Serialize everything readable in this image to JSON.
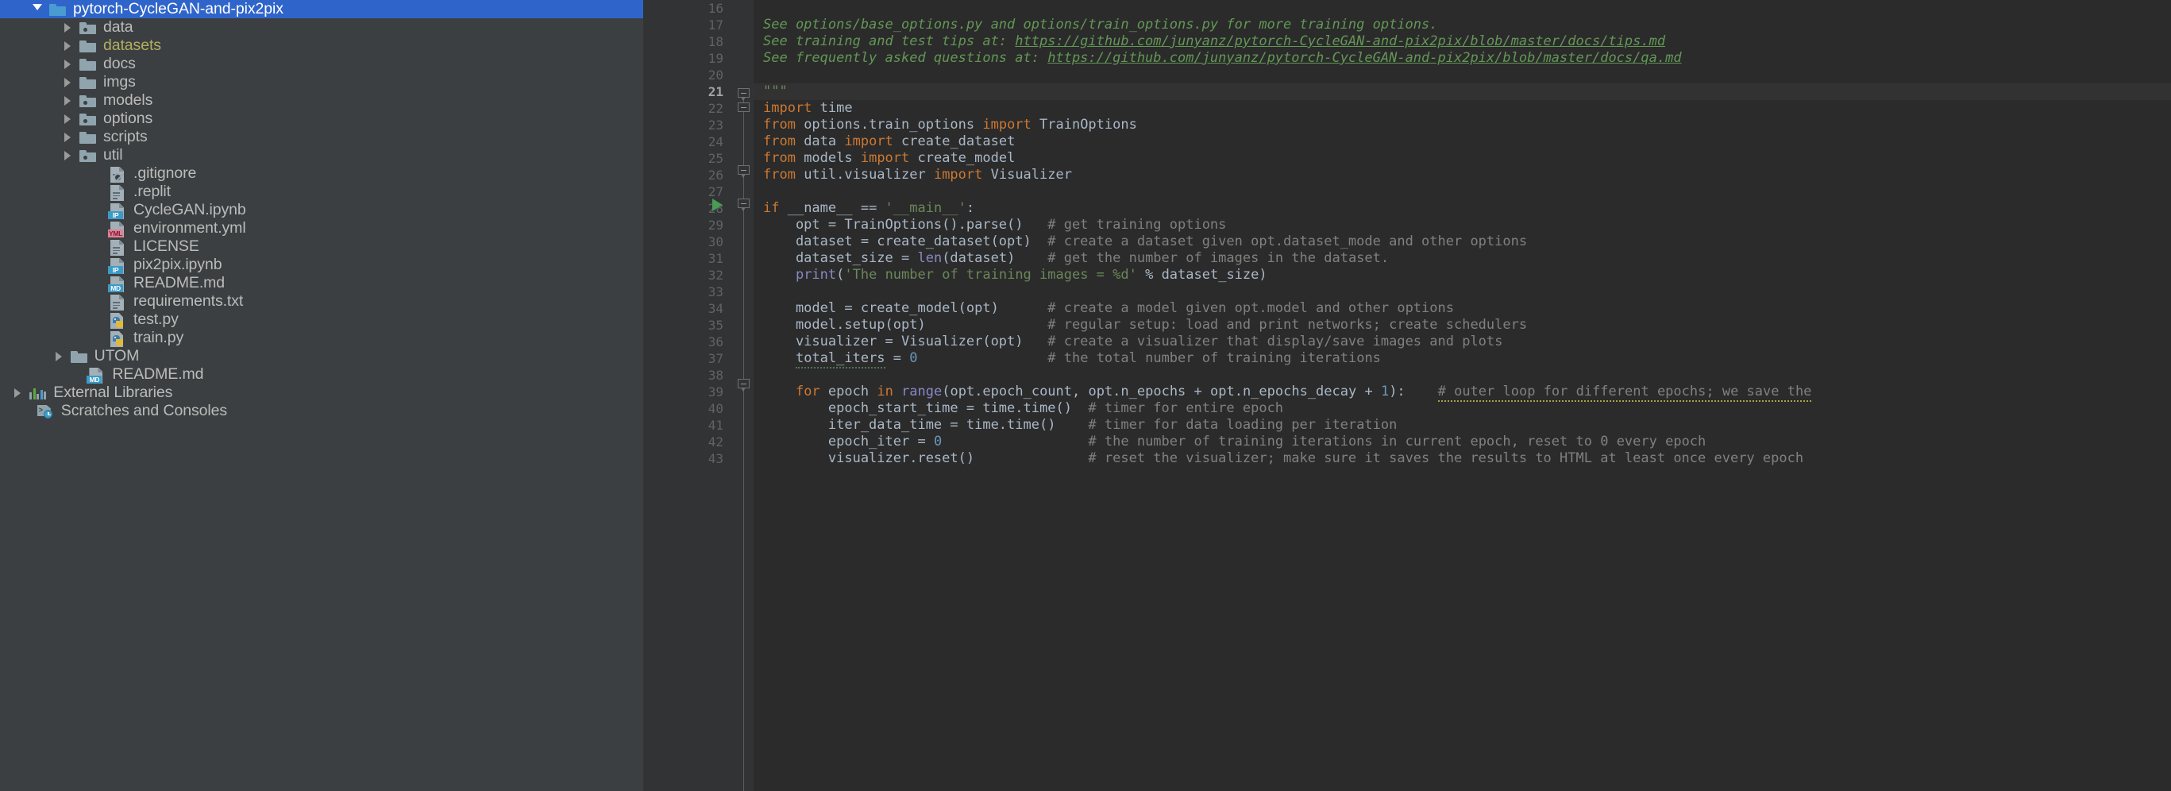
{
  "sidebar": {
    "items": [
      {
        "label": "pytorch-CycleGAN-and-pix2pix",
        "icon": "folder-open-icon",
        "kind": "folder",
        "indent": 1,
        "arrow": "open",
        "selected": true
      },
      {
        "label": "data",
        "icon": "folder-module-icon",
        "kind": "folder-module",
        "indent": 2,
        "arrow": "closed",
        "selected": false
      },
      {
        "label": "datasets",
        "icon": "folder-icon",
        "kind": "folder",
        "indent": 2,
        "arrow": "closed",
        "selected": false,
        "color": "yellow"
      },
      {
        "label": "docs",
        "icon": "folder-icon",
        "kind": "folder",
        "indent": 2,
        "arrow": "closed",
        "selected": false
      },
      {
        "label": "imgs",
        "icon": "folder-icon",
        "kind": "folder",
        "indent": 2,
        "arrow": "closed",
        "selected": false
      },
      {
        "label": "models",
        "icon": "folder-module-icon",
        "kind": "folder-module",
        "indent": 2,
        "arrow": "closed",
        "selected": false
      },
      {
        "label": "options",
        "icon": "folder-module-icon",
        "kind": "folder-module",
        "indent": 2,
        "arrow": "closed",
        "selected": false
      },
      {
        "label": "scripts",
        "icon": "folder-icon",
        "kind": "folder",
        "indent": 2,
        "arrow": "closed",
        "selected": false
      },
      {
        "label": "util",
        "icon": "folder-module-icon",
        "kind": "folder-module",
        "indent": 2,
        "arrow": "closed",
        "selected": false
      },
      {
        "label": ".gitignore",
        "icon": "gitignore-file-icon",
        "kind": "file-gitignore",
        "indent": 3,
        "arrow": "none",
        "selected": false
      },
      {
        "label": ".replit",
        "icon": "text-file-icon",
        "kind": "file-text",
        "indent": 3,
        "arrow": "none",
        "selected": false
      },
      {
        "label": "CycleGAN.ipynb",
        "icon": "notebook-file-icon",
        "kind": "file-badge",
        "badge": "IP",
        "badge_class": "ip",
        "indent": 3,
        "arrow": "none",
        "selected": false
      },
      {
        "label": "environment.yml",
        "icon": "yaml-file-icon",
        "kind": "file-badge",
        "badge": "YML",
        "badge_class": "yml",
        "indent": 3,
        "arrow": "none",
        "selected": false
      },
      {
        "label": "LICENSE",
        "icon": "text-file-icon",
        "kind": "file-text",
        "indent": 3,
        "arrow": "none",
        "selected": false
      },
      {
        "label": "pix2pix.ipynb",
        "icon": "notebook-file-icon",
        "kind": "file-badge",
        "badge": "IP",
        "badge_class": "ip",
        "indent": 3,
        "arrow": "none",
        "selected": false
      },
      {
        "label": "README.md",
        "icon": "markdown-file-icon",
        "kind": "file-badge",
        "badge": "MD",
        "badge_class": "md",
        "indent": 3,
        "arrow": "none",
        "selected": false
      },
      {
        "label": "requirements.txt",
        "icon": "text-file-icon",
        "kind": "file-text",
        "indent": 3,
        "arrow": "none",
        "selected": false
      },
      {
        "label": "test.py",
        "icon": "python-file-icon",
        "kind": "file-python",
        "indent": 3,
        "arrow": "none",
        "selected": false
      },
      {
        "label": "train.py",
        "icon": "python-file-icon",
        "kind": "file-python",
        "indent": 3,
        "arrow": "none",
        "selected": false
      },
      {
        "label": "UTOM",
        "icon": "folder-icon",
        "kind": "folder",
        "indent": 1.7,
        "arrow": "closed",
        "selected": false
      },
      {
        "label": "README.md",
        "icon": "markdown-file-icon",
        "kind": "file-badge",
        "badge": "MD",
        "badge_class": "md",
        "indent": 2.3,
        "arrow": "none",
        "selected": false
      },
      {
        "label": "External Libraries",
        "icon": "library-icon",
        "kind": "library",
        "indent": 0.35,
        "arrow": "closed",
        "selected": false
      },
      {
        "label": "Scratches and Consoles",
        "icon": "scratches-icon",
        "kind": "scratches",
        "indent": 0.6,
        "arrow": "none",
        "selected": false
      }
    ]
  },
  "editor": {
    "first_line_number": 16,
    "active_line_number": 21,
    "run_marker_line": 28,
    "line_numbers": [
      16,
      17,
      18,
      19,
      20,
      21,
      22,
      23,
      24,
      25,
      26,
      27,
      28,
      29,
      30,
      31,
      32,
      33,
      34,
      35,
      36,
      37,
      38,
      39,
      40,
      41,
      42,
      43
    ],
    "colors": {
      "background": "#2B2B2B",
      "gutter_background": "#313335",
      "sidebar_background": "#3C3F41",
      "selection_blue": "#2F65CA",
      "keyword_orange": "#CC7832",
      "string_green": "#6A8759",
      "docstring_green": "#629755",
      "comment_gray": "#808080",
      "number_blue": "#6897BB",
      "builtin_purple": "#8888C6",
      "identifier": "#A9B7C6",
      "current_line": "#323232"
    },
    "lines": [
      {
        "n": 16,
        "text": ""
      },
      {
        "n": 17,
        "text": "See options/base_options.py and options/train_options.py for more training options."
      },
      {
        "n": 18,
        "text": "See training and test tips at: https://github.com/junyanz/pytorch-CycleGAN-and-pix2pix/blob/master/docs/tips.md"
      },
      {
        "n": 19,
        "text": "See frequently asked questions at: https://github.com/junyanz/pytorch-CycleGAN-and-pix2pix/blob/master/docs/qa.md"
      },
      {
        "n": 20,
        "text": ""
      },
      {
        "n": 21,
        "text": "\"\"\""
      },
      {
        "n": 22,
        "text": "import time"
      },
      {
        "n": 23,
        "text": "from options.train_options import TrainOptions"
      },
      {
        "n": 24,
        "text": "from data import create_dataset"
      },
      {
        "n": 25,
        "text": "from models import create_model"
      },
      {
        "n": 26,
        "text": "from util.visualizer import Visualizer"
      },
      {
        "n": 27,
        "text": ""
      },
      {
        "n": 28,
        "text": "if __name__ == '__main__':"
      },
      {
        "n": 29,
        "text": "    opt = TrainOptions().parse()   # get training options"
      },
      {
        "n": 30,
        "text": "    dataset = create_dataset(opt)  # create a dataset given opt.dataset_mode and other options"
      },
      {
        "n": 31,
        "text": "    dataset_size = len(dataset)    # get the number of images in the dataset."
      },
      {
        "n": 32,
        "text": "    print('The number of training images = %d' % dataset_size)"
      },
      {
        "n": 33,
        "text": ""
      },
      {
        "n": 34,
        "text": "    model = create_model(opt)      # create a model given opt.model and other options"
      },
      {
        "n": 35,
        "text": "    model.setup(opt)               # regular setup: load and print networks; create schedulers"
      },
      {
        "n": 36,
        "text": "    visualizer = Visualizer(opt)   # create a visualizer that display/save images and plots"
      },
      {
        "n": 37,
        "text": "    total_iters = 0                # the total number of training iterations"
      },
      {
        "n": 38,
        "text": ""
      },
      {
        "n": 39,
        "text": "    for epoch in range(opt.epoch_count, opt.n_epochs + opt.n_epochs_decay + 1):    # outer loop for different epochs; we save the"
      },
      {
        "n": 40,
        "text": "        epoch_start_time = time.time()  # timer for entire epoch"
      },
      {
        "n": 41,
        "text": "        iter_data_time = time.time()    # timer for data loading per iteration"
      },
      {
        "n": 42,
        "text": "        epoch_iter = 0                  # the number of training iterations in current epoch, reset to 0 every epoch"
      },
      {
        "n": 43,
        "text": "        visualizer.reset()              # reset the visualizer; make sure it saves the results to HTML at least once every epoch"
      }
    ],
    "urls": {
      "tips": "https://github.com/junyanz/pytorch-CycleGAN-and-pix2pix/blob/master/docs/tips.md",
      "qa": "https://github.com/junyanz/pytorch-CycleGAN-and-pix2pix/blob/master/docs/qa.md"
    }
  }
}
